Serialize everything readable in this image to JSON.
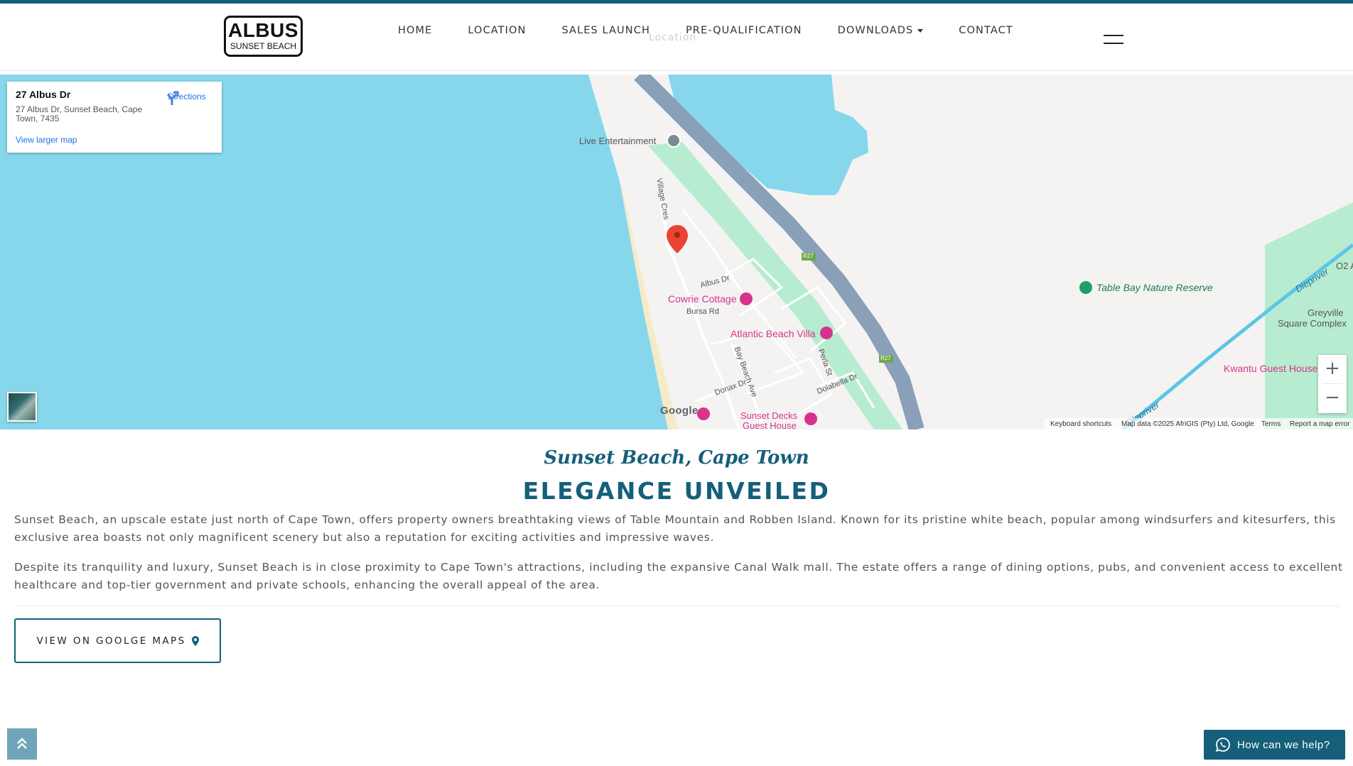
{
  "header": {
    "logo_main": "ALBUS",
    "logo_sub": "SUNSET BEACH",
    "ghost_label": "Location",
    "nav": [
      {
        "label": "HOME"
      },
      {
        "label": "LOCATION"
      },
      {
        "label": "SALES LAUNCH"
      },
      {
        "label": "PRE-QUALIFICATION"
      },
      {
        "label": "DOWNLOADS",
        "dropdown": true
      },
      {
        "label": "CONTACT"
      }
    ]
  },
  "map": {
    "info_card": {
      "title": "27 Albus Dr",
      "address": "27 Albus Dr, Sunset Beach, Cape Town, 7435",
      "directions": "Directions",
      "larger_map": "View larger map"
    },
    "labels": {
      "live_entertainment": "Live Entertainment",
      "village_cres": "Village Cres",
      "albus_dr": "Albus Dr",
      "cowrie_cottage": "Cowrie Cottage",
      "bursa_rd": "Bursa Rd",
      "atlantic_beach_villa": "Atlantic Beach Villa",
      "bay_beach_ave": "Bay Beach Ave",
      "perla_st": "Perla St",
      "donax_dr": "Donax Dr",
      "dolabella_dr": "Dolabella Dr",
      "sunset_decks_1": "Sunset Decks",
      "sunset_decks_2": "Guest House",
      "table_bay": "Table Bay Nature Reserve",
      "diepriver_1": "Diepriver",
      "diepriver_2": "Diepriver",
      "greyville_1": "Greyville",
      "greyville_2": "Square Complex",
      "kwantu": "Kwantu Guest House",
      "o2": "O2 A",
      "r27_a": "R27",
      "r27_b": "R27"
    },
    "google_logo": "Google",
    "footer": {
      "shortcuts": "Keyboard shortcuts",
      "mapdata": "Map data ©2025 AfriGIS (Pty) Ltd, Google",
      "terms": "Terms",
      "report": "Report a map error"
    },
    "zoom_in": "+",
    "zoom_out": "−",
    "colors": {
      "water": "#87d7ec",
      "road": "#8aa0b8",
      "park": "#b7ecd0",
      "poi": "#d6338d"
    }
  },
  "content": {
    "subtitle": "Sunset Beach, Cape Town",
    "headline": "ELEGANCE UNVEILED",
    "para1": "Sunset Beach, an upscale estate just north of Cape Town, offers property owners breathtaking views of Table Mountain and Robben Island. Known for its pristine white beach, popular among windsurfers and kitesurfers, this exclusive area boasts not only magnificent scenery but also a reputation for exciting activities and impressive waves.",
    "para2": "Despite its tranquility and luxury, Sunset Beach is in close proximity to Cape Town's attractions, including the expansive Canal Walk mall. The estate offers a range of dining options, pubs, and convenient access to excellent healthcare and top-tier government and private schools, enhancing the overall appeal of the area.",
    "maps_button": "VIEW ON GOOLGE MAPS"
  },
  "widgets": {
    "whatsapp": "How can we help?",
    "accent": "#155f7a"
  }
}
